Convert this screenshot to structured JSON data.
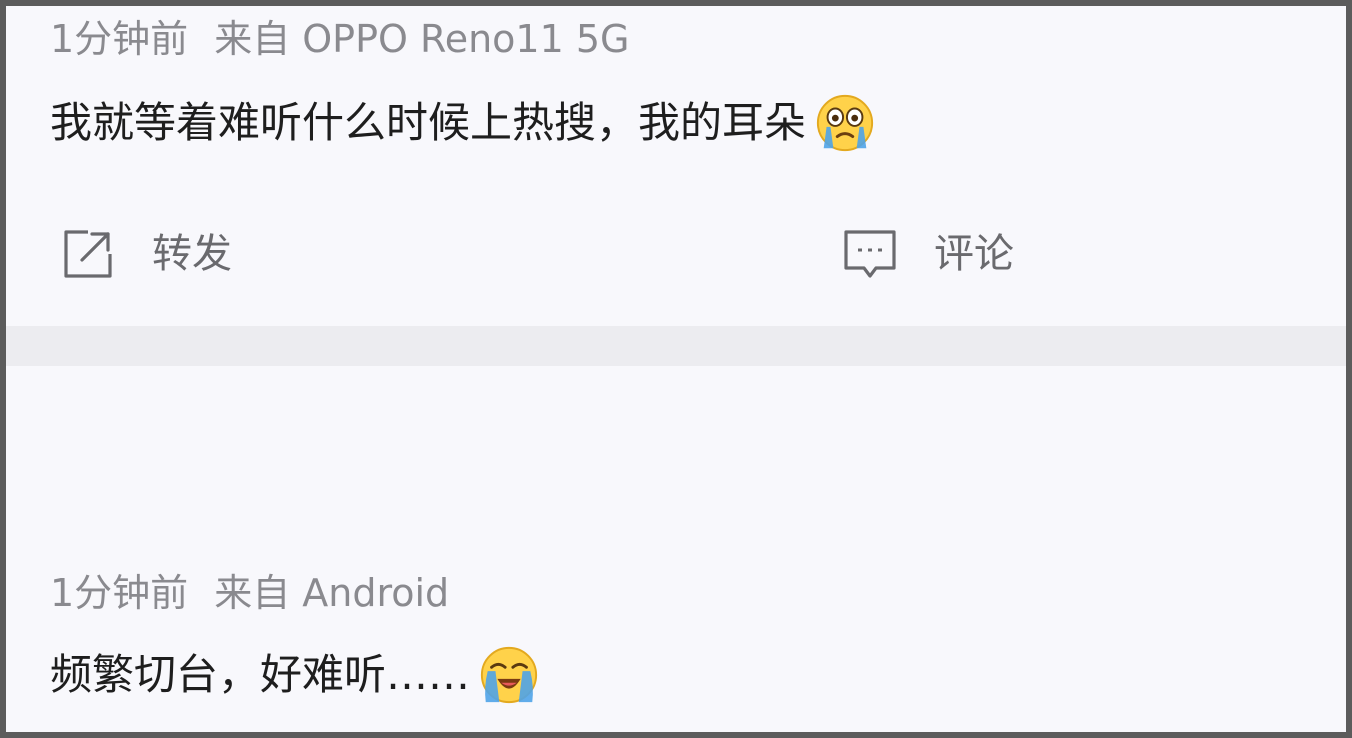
{
  "posts": [
    {
      "time": "1分钟前",
      "source": "来自 OPPO Reno11 5G",
      "text": "我就等着难听什么时候上热搜，我的耳朵",
      "emoji": "crying-face-emoji",
      "actions": {
        "forward": {
          "label": "转发",
          "icon": "share-icon"
        },
        "comment": {
          "label": "评论",
          "icon": "comment-icon"
        }
      }
    },
    {
      "time": "1分钟前",
      "source": "来自 Android",
      "text": "频繁切台，好难听……",
      "emoji": "loudly-crying-face-emoji"
    }
  ],
  "colors": {
    "background": "#f8f8fc",
    "divider": "#ececf0",
    "meta_text": "#8a8a8f",
    "body_text": "#1e1e1e",
    "action_text": "#6a6a6e",
    "emoji_yellow": "#ffd24a",
    "tear_blue": "#4fa3e8"
  }
}
